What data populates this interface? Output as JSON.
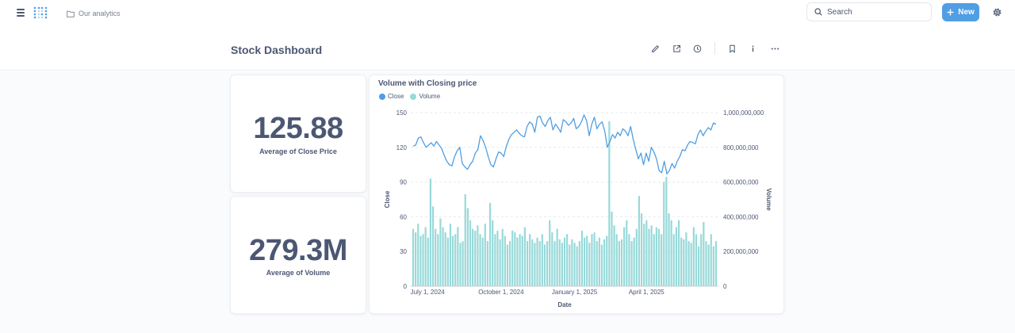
{
  "header": {
    "breadcrumb": "Our analytics",
    "search_label": "Search",
    "new_label": "New"
  },
  "dashboard": {
    "title": "Stock Dashboard"
  },
  "kpis": [
    {
      "value": "125.88",
      "label": "Average of Close Price"
    },
    {
      "value": "279.3M",
      "label": "Average of Volume"
    }
  ],
  "colors": {
    "accent": "#509ee3",
    "close_line": "#509ee3",
    "volume_bar": "#98d9d9",
    "text": "#4c5773"
  },
  "icons": [
    "menu-icon",
    "logo-icon",
    "folder-icon",
    "search-icon",
    "plus-icon",
    "gear-icon",
    "pencil-icon",
    "share-icon",
    "history-icon",
    "bookmark-icon",
    "info-icon",
    "more-icon"
  ],
  "chart_data": {
    "type": "bar",
    "title": "Volume with Closing price",
    "xlabel": "Date",
    "ylabel": "Close",
    "y2label": "Volume",
    "legend": [
      "Close",
      "Volume"
    ],
    "legend_position": "top-left",
    "grid": true,
    "ylim": [
      0,
      150
    ],
    "y2lim": [
      0,
      1000000000
    ],
    "yticks": [
      "0",
      "30",
      "60",
      "90",
      "120",
      "150"
    ],
    "y2ticks": [
      "0",
      "200,000,000",
      "400,000,000",
      "600,000,000",
      "800,000,000",
      "1,000,000,000"
    ],
    "xticks": [
      "July 1, 2024",
      "October 1, 2024",
      "January 1, 2025",
      "April 1, 2025"
    ],
    "x_start": "2024-06-10",
    "x_end": "2025-06-30",
    "tick_dates": [
      "2024-07-01",
      "2024-10-01",
      "2025-01-01",
      "2025-04-01"
    ],
    "series": [
      {
        "name": "Close",
        "type": "line",
        "axis": "left",
        "values": [
          121,
          122,
          128,
          129,
          124,
          120,
          122,
          124,
          121,
          125,
          122,
          119,
          113,
          108,
          105,
          104,
          112,
          117,
          120,
          106,
          103,
          101,
          105,
          108,
          115,
          118,
          130,
          126,
          120,
          112,
          105,
          103,
          110,
          116,
          115,
          112,
          121,
          127,
          131,
          133,
          135,
          132,
          130,
          129,
          138,
          142,
          140,
          133,
          146,
          147,
          141,
          138,
          143,
          146,
          135,
          140,
          137,
          133,
          144,
          142,
          139,
          141,
          145,
          136,
          138,
          142,
          148,
          143,
          130,
          140,
          146,
          136,
          140,
          142,
          134,
          120,
          125,
          131,
          128,
          133,
          130,
          136,
          134,
          130,
          138,
          127,
          118,
          110,
          115,
          105,
          115,
          108,
          120,
          116,
          110,
          100,
          98,
          108,
          97,
          100,
          106,
          102,
          108,
          112,
          118,
          117,
          122,
          125,
          124,
          123,
          131,
          135,
          130,
          134,
          137,
          135,
          141,
          140
        ]
      },
      {
        "name": "Volume",
        "type": "bar",
        "axis": "right",
        "values": [
          330,
          310,
          360,
          290,
          300,
          340,
          280,
          620,
          460,
          330,
          300,
          390,
          340,
          310,
          280,
          360,
          290,
          300,
          340,
          250,
          260,
          530,
          450,
          380,
          330,
          320,
          350,
          300,
          280,
          360,
          260,
          480,
          380,
          300,
          320,
          270,
          330,
          290,
          240,
          260,
          320,
          310,
          280,
          300,
          290,
          340,
          260,
          300,
          270,
          250,
          280,
          260,
          300,
          240,
          260,
          380,
          310,
          260,
          330,
          270,
          250,
          280,
          300,
          240,
          270,
          250,
          230,
          260,
          320,
          280,
          290,
          250,
          300,
          310,
          260,
          280,
          240,
          270,
          290,
          950,
          430,
          350,
          300,
          260,
          270,
          340,
          380,
          300,
          260,
          280,
          330,
          520,
          420,
          360,
          380,
          330,
          350,
          300,
          340,
          330,
          300,
          600,
          630,
          420,
          380,
          300,
          340,
          380,
          280,
          270,
          310,
          260,
          250,
          340,
          300,
          230,
          300,
          370,
          260,
          240,
          300,
          230,
          260
        ]
      }
    ]
  }
}
